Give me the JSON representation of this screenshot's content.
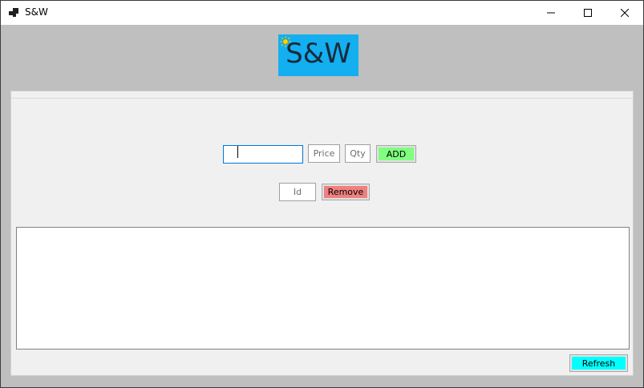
{
  "window": {
    "title": "S&W"
  },
  "logo": {
    "text": "S&W"
  },
  "form": {
    "name_value": "",
    "price_placeholder": "Price",
    "qty_placeholder": "Qty",
    "add_label": "ADD",
    "id_placeholder": "Id",
    "remove_label": "Remove",
    "refresh_label": "Refresh"
  },
  "colors": {
    "logo_bg": "#13aff0",
    "add_button": "#80ff80",
    "remove_button": "#f08080",
    "refresh_button": "#00ffff"
  },
  "icons": {
    "app": "app-icon",
    "minimize": "minimize-icon",
    "maximize": "maximize-icon",
    "close": "close-icon",
    "sun": "sun-icon"
  },
  "list": {
    "items": []
  }
}
